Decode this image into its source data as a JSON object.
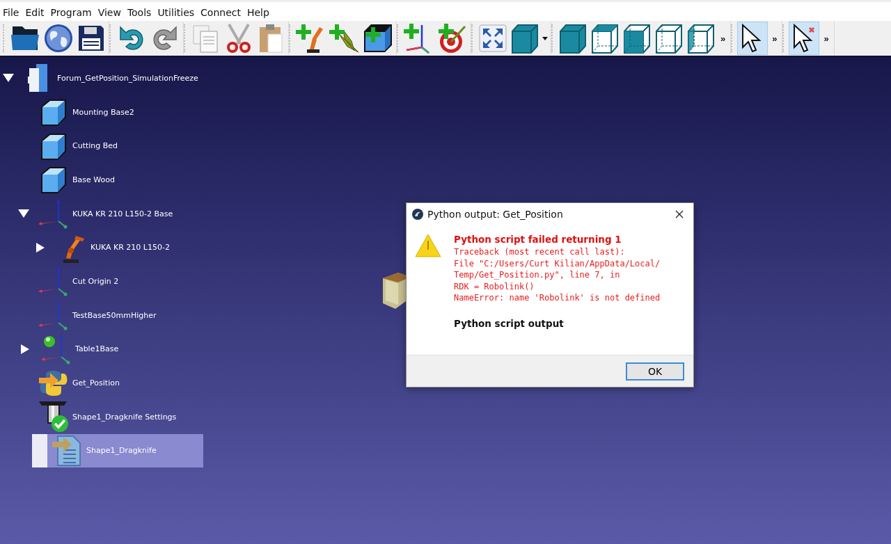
{
  "menu": [
    "File",
    "Edit",
    "Program",
    "View",
    "Tools",
    "Utilities",
    "Connect",
    "Help"
  ],
  "toolbar": [
    {
      "buttons": [
        {
          "kind": "open",
          "on": false
        },
        {
          "kind": "globe",
          "on": false
        },
        {
          "kind": "save",
          "on": false
        }
      ]
    },
    {
      "buttons": [
        {
          "kind": "undo",
          "on": false
        },
        {
          "kind": "redo",
          "on": false
        }
      ]
    },
    {
      "buttons": [
        {
          "kind": "copy",
          "on": false
        },
        {
          "kind": "cut",
          "on": false
        },
        {
          "kind": "paste",
          "on": false
        }
      ]
    },
    {
      "buttons": [
        {
          "kind": "add-robot",
          "on": false
        },
        {
          "kind": "add-tool",
          "on": false
        },
        {
          "kind": "add-object",
          "on": false
        }
      ]
    },
    {
      "buttons": [
        {
          "kind": "add-frame",
          "on": false
        },
        {
          "kind": "add-target",
          "on": false
        }
      ]
    },
    {
      "buttons": [
        {
          "kind": "fit",
          "on": false
        },
        {
          "kind": "cube-menu",
          "on": false
        }
      ]
    },
    {
      "buttons": [
        {
          "kind": "cube-solid",
          "on": false
        },
        {
          "kind": "cube-top",
          "on": false
        },
        {
          "kind": "cube-side",
          "on": false
        },
        {
          "kind": "cube-wire",
          "on": false
        },
        {
          "kind": "cube-back",
          "on": false
        }
      ],
      "more": "»"
    },
    {
      "buttons": [
        {
          "kind": "pointer",
          "on": true
        }
      ],
      "more": "»"
    },
    {
      "buttons": [
        {
          "kind": "pointer-x",
          "on": true
        }
      ],
      "more": "»"
    }
  ],
  "tree": [
    {
      "label": "Forum_GetPosition_SimulationFreeze",
      "kind": "station",
      "selected": false,
      "expanded": true,
      "children": [
        {
          "label": "Mounting Base2",
          "kind": "object",
          "selected": false
        },
        {
          "label": "Cutting Bed",
          "kind": "object",
          "selected": false
        },
        {
          "label": "Base Wood",
          "kind": "object",
          "selected": false
        },
        {
          "label": "KUKA KR 210 L150-2 Base",
          "kind": "frame",
          "selected": false,
          "expanded": true,
          "children": [
            {
              "label": "KUKA KR 210 L150-2",
              "kind": "robot",
              "selected": false,
              "expanded": false
            }
          ]
        },
        {
          "label": "Cut Origin 2",
          "kind": "frame",
          "selected": false
        },
        {
          "label": "TestBase50mmHigher",
          "kind": "frame",
          "selected": false
        },
        {
          "label": "Table1Base",
          "kind": "frame-active",
          "selected": false,
          "expanded": false
        },
        {
          "label": "Get_Position",
          "kind": "python",
          "selected": false
        },
        {
          "label": "Shape1_Dragknife Settings",
          "kind": "settings",
          "selected": false
        },
        {
          "label": "Shape1_Dragknife",
          "kind": "program",
          "selected": true
        }
      ]
    }
  ],
  "dialog": {
    "title": "Python output: Get_Position",
    "heading": "Python script failed returning 1",
    "traceback": [
      "Traceback (most recent call last):",
      "File \"C:/Users/Curt Kilian/AppData/Local/",
      "Temp/Get_Position.py\", line 7, in",
      "RDK = Robolink()",
      "NameError: name 'Robolink' is not defined"
    ],
    "output_heading": "Python script output",
    "button": "OK"
  }
}
